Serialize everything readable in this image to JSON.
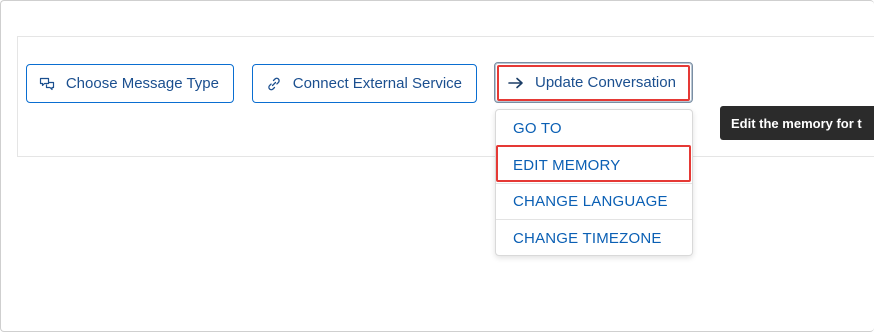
{
  "toolbar": {
    "choose_label": "Choose Message Type",
    "choose_icon": "chat-bubbles-icon",
    "connect_label": "Connect External Service",
    "connect_icon": "link-icon",
    "update_label": "Update Conversation",
    "update_icon": "arrow-right-icon"
  },
  "menu": {
    "items": [
      {
        "label": "GO TO"
      },
      {
        "label": "EDIT MEMORY"
      },
      {
        "label": "CHANGE LANGUAGE"
      },
      {
        "label": "CHANGE TIMEZONE"
      }
    ]
  },
  "tooltip": {
    "text": "Edit the memory for t"
  },
  "colors": {
    "accent": "#0a6ed1",
    "highlight": "#e53935",
    "tooltip_bg": "#2b2b2b"
  }
}
